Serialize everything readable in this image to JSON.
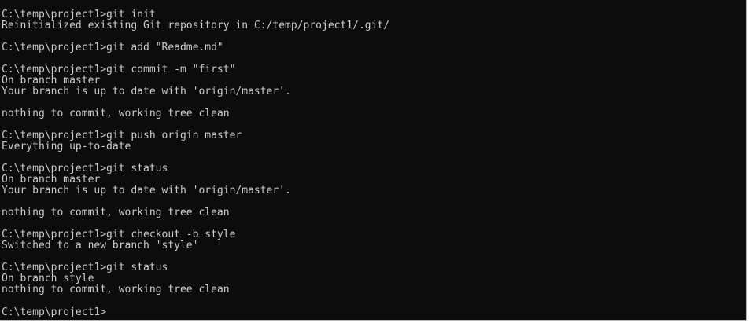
{
  "window": {
    "title": "",
    "lines": [
      "C:\\temp\\project1>git init",
      "Reinitialized existing Git repository in C:/temp/project1/.git/",
      "",
      "C:\\temp\\project1>git add \"Readme.md\"",
      "",
      "C:\\temp\\project1>git commit -m \"first\"",
      "On branch master",
      "Your branch is up to date with 'origin/master'.",
      "",
      "nothing to commit, working tree clean",
      "",
      "C:\\temp\\project1>git push origin master",
      "Everything up-to-date",
      "",
      "C:\\temp\\project1>git status",
      "On branch master",
      "Your branch is up to date with 'origin/master'.",
      "",
      "nothing to commit, working tree clean",
      "",
      "C:\\temp\\project1>git checkout -b style",
      "Switched to a new branch 'style'",
      "",
      "C:\\temp\\project1>git status",
      "On branch style",
      "nothing to commit, working tree clean",
      "",
      "C:\\temp\\project1>"
    ]
  }
}
